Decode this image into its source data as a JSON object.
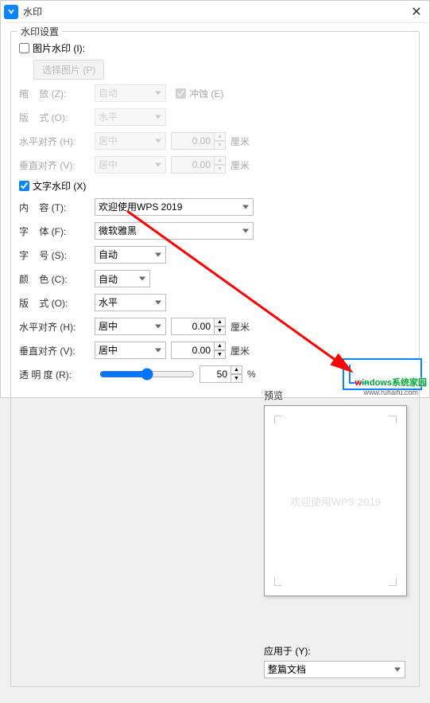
{
  "titlebar": {
    "title": "水印"
  },
  "fieldset": {
    "legend": "水印设置"
  },
  "image_wm": {
    "checkbox_label": "图片水印 (I):",
    "select_image_btn": "选择图片 (P)",
    "scale_label": "缩    放 (Z):",
    "scale_value": "自动",
    "washout_label": "冲蚀 (E)",
    "layout_label": "版    式 (O):",
    "layout_value": "水平",
    "halign_label": "水平对齐 (H):",
    "halign_value": "居中",
    "halign_offset": "0.00",
    "valign_label": "垂直对齐 (V):",
    "valign_value": "居中",
    "valign_offset": "0.00",
    "unit": "厘米"
  },
  "text_wm": {
    "checkbox_label": "文字水印 (X)",
    "content_label": "内    容 (T):",
    "content_value": "欢迎使用WPS 2019",
    "font_label": "字    体 (F):",
    "font_value": "微软雅黑",
    "size_label": "字    号 (S):",
    "size_value": "自动",
    "color_label": "颜    色 (C):",
    "color_value": "自动",
    "layout_label": "版    式 (O):",
    "layout_value": "水平",
    "halign_label": "水平对齐 (H):",
    "halign_value": "居中",
    "halign_offset": "0.00",
    "valign_label": "垂直对齐 (V):",
    "valign_value": "居中",
    "valign_offset": "0.00",
    "unit": "厘米",
    "opacity_label": "透 明 度 (R):",
    "opacity_value": "50",
    "opacity_unit": "%"
  },
  "preview": {
    "label": "预览",
    "text": "欢迎使用WPS 2019"
  },
  "apply": {
    "label": "应用于 (Y):",
    "value": "整篇文档"
  },
  "logo": {
    "text1": "w",
    "text2": "indows系统家园",
    "sub": "www.ruhaifu.com"
  }
}
